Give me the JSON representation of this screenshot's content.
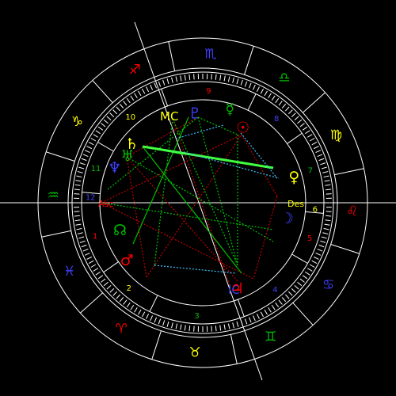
{
  "wheel": {
    "zodiac_signs": [
      {
        "glyph": "♒",
        "color": "#00c000"
      },
      {
        "glyph": "♑",
        "color": "#ffff00"
      },
      {
        "glyph": "♐",
        "color": "#ff0000"
      },
      {
        "glyph": "♏",
        "color": "#4040ff"
      },
      {
        "glyph": "♎",
        "color": "#00c000"
      },
      {
        "glyph": "♍",
        "color": "#ffff00"
      },
      {
        "glyph": "♌",
        "color": "#ff0000"
      },
      {
        "glyph": "♋",
        "color": "#4040ff"
      },
      {
        "glyph": "♊",
        "color": "#00c000"
      },
      {
        "glyph": "♉",
        "color": "#ffff00"
      },
      {
        "glyph": "♈",
        "color": "#ff0000"
      },
      {
        "glyph": "♓",
        "color": "#4040ff"
      }
    ],
    "houses": [
      {
        "label": "1",
        "color": "#ff0000"
      },
      {
        "label": "2",
        "color": "#ffff00"
      },
      {
        "label": "3",
        "color": "#00c000"
      },
      {
        "label": "4",
        "color": "#4040ff"
      },
      {
        "label": "5",
        "color": "#ff0000"
      },
      {
        "label": "6",
        "color": "#ffff00"
      },
      {
        "label": "7",
        "color": "#00c000"
      },
      {
        "label": "8",
        "color": "#4040ff"
      },
      {
        "label": "9",
        "color": "#ff0000"
      },
      {
        "label": "10",
        "color": "#ffff00"
      },
      {
        "label": "11",
        "color": "#00c000"
      },
      {
        "label": "12",
        "color": "#4040ff"
      }
    ],
    "angles": {
      "asc": "Asc",
      "des": "Des",
      "mc": "MC",
      "ic": "IC"
    },
    "planets": [
      {
        "name": "saturn",
        "glyph": "♄",
        "color": "#ffff00"
      },
      {
        "name": "uranus",
        "glyph": "♅",
        "color": "#00c000"
      },
      {
        "name": "neptune",
        "glyph": "♆",
        "color": "#4040ff"
      },
      {
        "name": "pluto",
        "glyph": "♇",
        "color": "#4040ff"
      },
      {
        "name": "mercury",
        "glyph": "☿",
        "color": "#00c000"
      },
      {
        "name": "sun",
        "glyph": "☉",
        "color": "#ff0000"
      },
      {
        "name": "venus",
        "glyph": "♀",
        "color": "#ffff00"
      },
      {
        "name": "moon",
        "glyph": "☽",
        "color": "#4040ff"
      },
      {
        "name": "jupiter",
        "glyph": "♃",
        "color": "#ff0000"
      },
      {
        "name": "mars",
        "glyph": "♂",
        "color": "#ff0000"
      },
      {
        "name": "node",
        "glyph": "☊",
        "color": "#00c000"
      }
    ],
    "aspect_colors": {
      "red": "#c00000",
      "green": "#00c000",
      "cyan": "#40c0ff"
    }
  }
}
